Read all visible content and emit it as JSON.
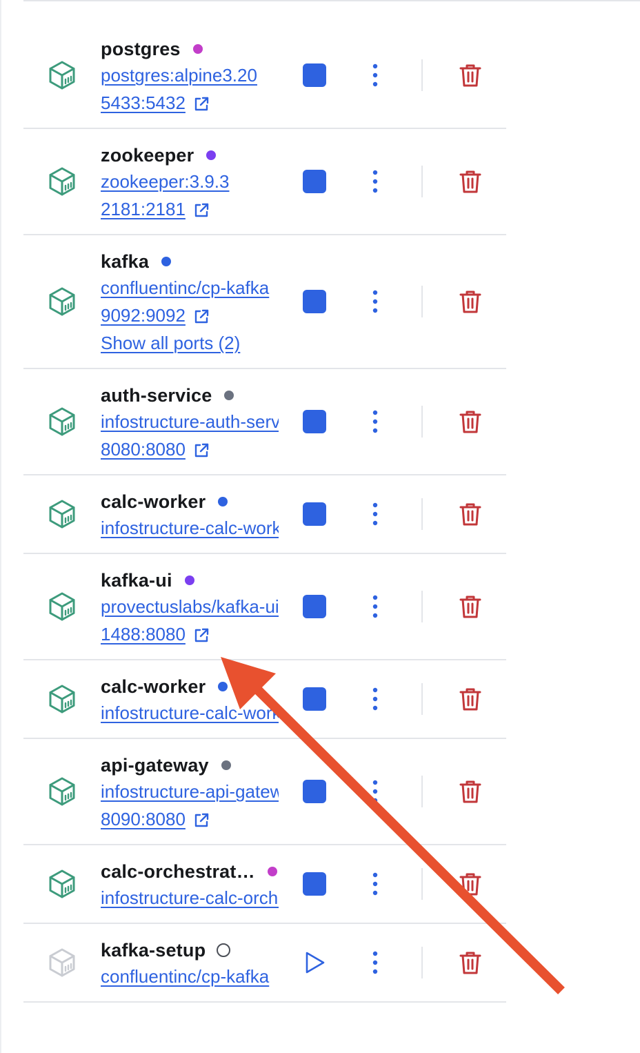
{
  "colors": {
    "link": "#2e62e0",
    "stop_button": "#2e62e0",
    "delete_icon": "#c2373a",
    "cube_running": "#3d9b7c",
    "cube_stopped": "#c9ccd2",
    "separator": "#e3e5e9",
    "annotation_arrow": "#e8512f"
  },
  "icons": {
    "container": "cube-icon",
    "open_external": "external-link-icon",
    "stop": "stop-square-icon",
    "start": "play-icon",
    "more": "kebab-menu-icon",
    "delete": "trash-icon"
  },
  "containers": [
    {
      "name": "postgres",
      "status_color": "#c23ec9",
      "running": true,
      "image": "postgres:alpine3.20",
      "ports": "5433:5432",
      "extra_ports": ""
    },
    {
      "name": "zookeeper",
      "status_color": "#7b3ff0",
      "running": true,
      "image": "zookeeper:3.9.3",
      "ports": "2181:2181",
      "extra_ports": ""
    },
    {
      "name": "kafka",
      "status_color": "#2e62e0",
      "running": true,
      "image": "confluentinc/cp-kafka",
      "ports": "9092:9092",
      "extra_ports": "Show all ports (2)"
    },
    {
      "name": "auth-service",
      "status_color": "#6b7280",
      "running": true,
      "image": "infostructure-auth-service",
      "ports": "8080:8080",
      "extra_ports": ""
    },
    {
      "name": "calc-worker",
      "status_color": "#2e62e0",
      "running": true,
      "image": "infostructure-calc-worker",
      "ports": "",
      "extra_ports": ""
    },
    {
      "name": "kafka-ui",
      "status_color": "#7b3ff0",
      "running": true,
      "image": "provectuslabs/kafka-ui",
      "ports": "1488:8080",
      "extra_ports": ""
    },
    {
      "name": "calc-worker",
      "status_color": "#2e62e0",
      "running": true,
      "image": "infostructure-calc-worker",
      "ports": "",
      "extra_ports": ""
    },
    {
      "name": "api-gateway",
      "status_color": "#6b7280",
      "running": true,
      "image": "infostructure-api-gateway",
      "ports": "8090:8080",
      "extra_ports": ""
    },
    {
      "name": "calc-orchestrat…",
      "status_color": "#c23ec9",
      "running": true,
      "image": "infostructure-calc-orchestrator",
      "ports": "",
      "extra_ports": ""
    },
    {
      "name": "kafka-setup",
      "status_color": "",
      "running": false,
      "image": "confluentinc/cp-kafka",
      "ports": "",
      "extra_ports": ""
    }
  ]
}
